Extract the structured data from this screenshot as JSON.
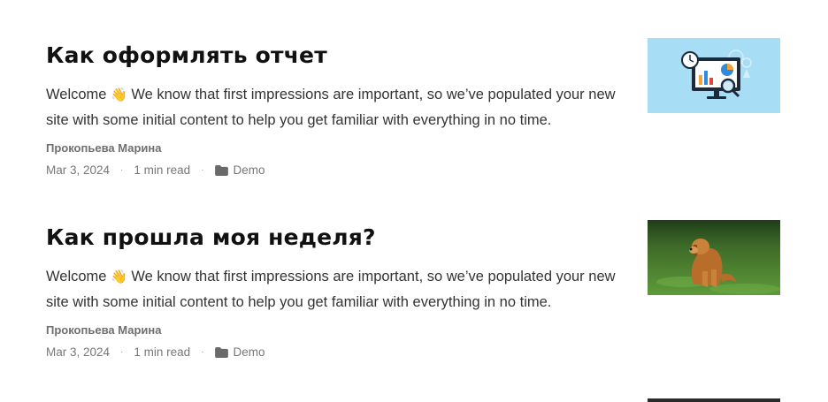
{
  "posts": [
    {
      "title": "Как оформлять отчет",
      "excerpt_before_emoji": "Welcome ",
      "emoji": "👋",
      "excerpt_after_emoji": " We know that first impressions are important, so we’ve populated your new site with some initial content to help you get familiar with everything in no time.",
      "author": "Прокопьева Марина",
      "date": "Mar 3, 2024",
      "read_time": "1 min read",
      "category": "Demo",
      "thumbnail": "analytics-dashboard-illustration"
    },
    {
      "title": "Как прошла моя неделя?",
      "excerpt_before_emoji": "Welcome ",
      "emoji": "👋",
      "excerpt_after_emoji": " We know that first impressions are important, so we’ve populated your new site with some initial content to help you get familiar with everything in no time.",
      "author": "Прокопьева Марина",
      "date": "Mar 3, 2024",
      "read_time": "1 min read",
      "category": "Demo",
      "thumbnail": "golden-retriever-on-grass-photo"
    }
  ],
  "meta_separator": "·",
  "colors": {
    "text": "#333333",
    "meta": "#777777",
    "title": "#111111",
    "thumb_bg": "#a8def5"
  }
}
